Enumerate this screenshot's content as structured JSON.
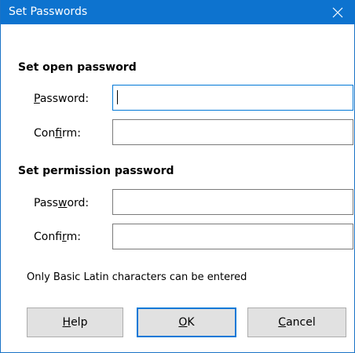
{
  "dialog": {
    "title": "Set Passwords",
    "close_icon": "close-icon"
  },
  "open_section": {
    "heading": "Set open password",
    "password_label": {
      "pre": "",
      "key": "P",
      "post": "assword:"
    },
    "password_value": "",
    "confirm_label": {
      "pre": "Con",
      "key": "f",
      "post": "irm:"
    },
    "confirm_value": ""
  },
  "permission_section": {
    "heading": "Set permission password",
    "password_label": {
      "pre": "Pass",
      "key": "w",
      "post": "ord:"
    },
    "password_value": "",
    "confirm_label": {
      "pre": "Confi",
      "key": "r",
      "post": "m:"
    },
    "confirm_value": ""
  },
  "note": "Only Basic Latin characters can be entered",
  "buttons": {
    "help": {
      "pre": "",
      "key": "H",
      "post": "elp"
    },
    "ok": {
      "pre": "",
      "key": "O",
      "post": "K"
    },
    "cancel": {
      "pre": "",
      "key": "C",
      "post": "ancel"
    }
  },
  "colors": {
    "titlebar": "#0d73cf",
    "focus_border": "#0078d7",
    "button_face": "#e1e1e1"
  }
}
